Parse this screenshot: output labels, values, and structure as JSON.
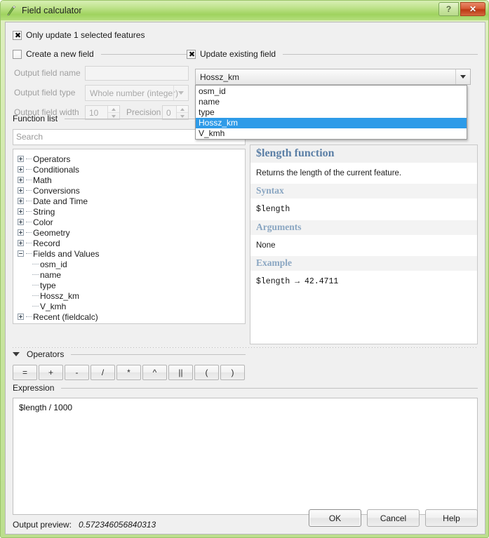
{
  "window": {
    "title": "Field calculator",
    "icon": "field-calculator-icon",
    "help_button": "?",
    "close_button": "✕"
  },
  "only_update": {
    "label": "Only update 1 selected features",
    "checked": true
  },
  "create_new_field": {
    "group_label": "Create a new field",
    "checked": false,
    "fields": {
      "name_label": "Output field name",
      "name_value": "",
      "type_label": "Output field type",
      "type_value": "Whole number (integer)",
      "width_label": "Output field width",
      "width_value": "10",
      "precision_label": "Precision",
      "precision_value": "0"
    }
  },
  "update_existing_field": {
    "group_label": "Update existing field",
    "checked": true,
    "selected_value": "Hossz_km",
    "dropdown_open": true,
    "options": [
      "osm_id",
      "name",
      "type",
      "Hossz_km",
      "V_kmh"
    ],
    "selected_index": 3
  },
  "function_list": {
    "group_label": "Function list",
    "search_placeholder": "Search",
    "search_value": "",
    "tree": [
      {
        "label": "Operators",
        "expanded": false
      },
      {
        "label": "Conditionals",
        "expanded": false
      },
      {
        "label": "Math",
        "expanded": false
      },
      {
        "label": "Conversions",
        "expanded": false
      },
      {
        "label": "Date and Time",
        "expanded": false
      },
      {
        "label": "String",
        "expanded": false
      },
      {
        "label": "Color",
        "expanded": false
      },
      {
        "label": "Geometry",
        "expanded": false
      },
      {
        "label": "Record",
        "expanded": false
      },
      {
        "label": "Fields and Values",
        "expanded": true,
        "children": [
          "osm_id",
          "name",
          "type",
          "Hossz_km",
          "V_kmh"
        ]
      },
      {
        "label": "Recent (fieldcalc)",
        "expanded": false
      }
    ]
  },
  "help": {
    "title": "$length function",
    "description": "Returns the length of the current feature.",
    "syntax_heading": "Syntax",
    "syntax_code": "$length",
    "arguments_heading": "Arguments",
    "arguments_text": "None",
    "example_heading": "Example",
    "example_code": "$length → 42.4711"
  },
  "operators": {
    "group_label": "Operators",
    "buttons": [
      "=",
      "+",
      "-",
      "/",
      "*",
      "^",
      "||",
      "(",
      ")"
    ]
  },
  "expression": {
    "group_label": "Expression",
    "value": "$length  / 1000"
  },
  "output_preview": {
    "label": "Output preview:",
    "value": "0.572346056840313"
  },
  "dialog_buttons": {
    "ok": "OK",
    "cancel": "Cancel",
    "help": "Help"
  },
  "colors": {
    "window_frame": "#9bc46a",
    "titlebar_green": "#9fd35f",
    "close_red": "#d85c36",
    "selection_blue": "#2e9be8",
    "help_heading": "#5b7fa6",
    "help_subheading": "#8aa6c2"
  }
}
